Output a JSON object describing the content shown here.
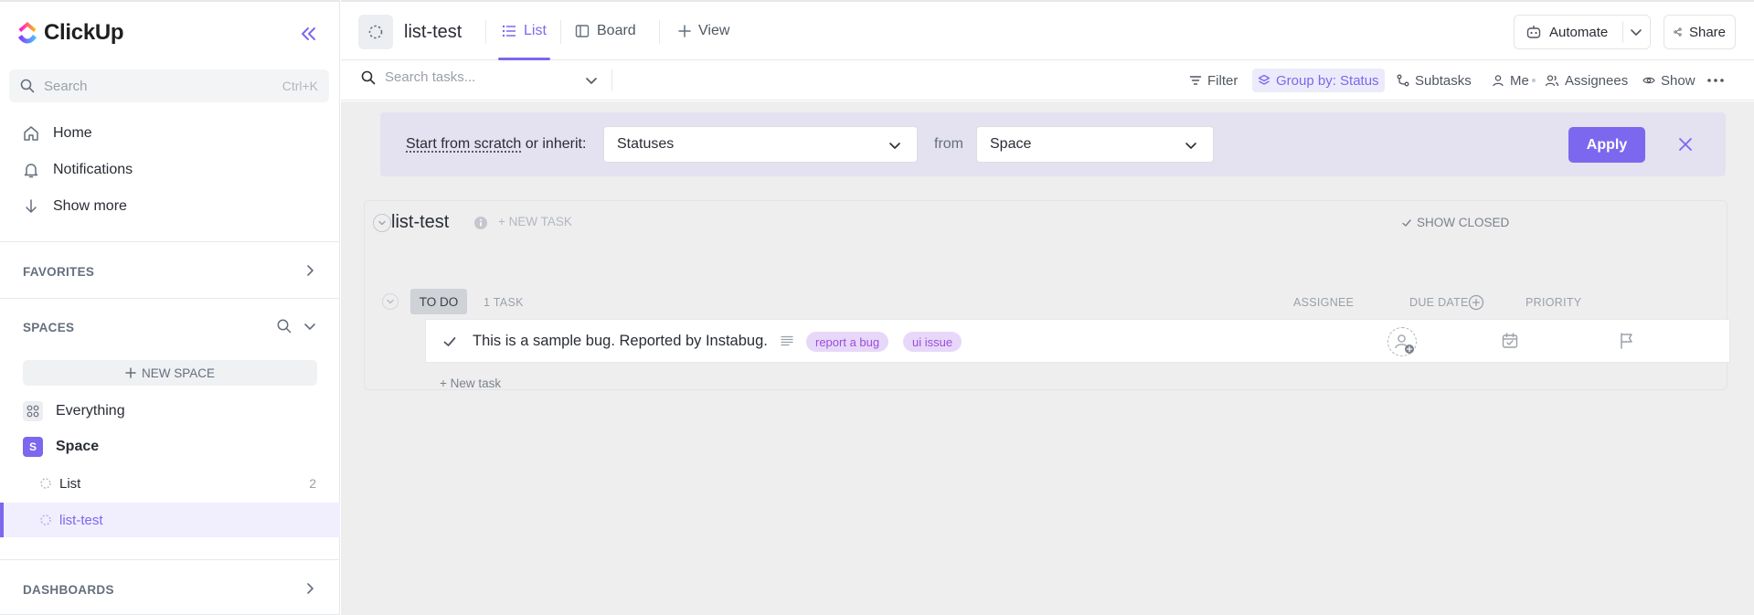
{
  "sidebar": {
    "brand": "ClickUp",
    "search": {
      "placeholder": "Search",
      "shortcut": "Ctrl+K"
    },
    "nav": [
      {
        "label": "Home",
        "icon": "home-icon"
      },
      {
        "label": "Notifications",
        "icon": "bell-icon"
      },
      {
        "label": "Show more",
        "icon": "arrow-down-icon"
      }
    ],
    "favorites_label": "FAVORITES",
    "spaces_label": "SPACES",
    "new_space_label": "NEW SPACE",
    "everything_label": "Everything",
    "space": {
      "initial": "S",
      "name": "Space"
    },
    "lists": [
      {
        "name": "List",
        "count": "2"
      },
      {
        "name": "list-test",
        "count": ""
      }
    ],
    "dashboards_label": "DASHBOARDS"
  },
  "header": {
    "list_title": "list-test",
    "tabs": [
      {
        "label": "List",
        "icon": "list-icon",
        "active": true
      },
      {
        "label": "Board",
        "icon": "board-icon",
        "active": false
      }
    ],
    "add_view_label": "View",
    "automate_label": "Automate",
    "share_label": "Share"
  },
  "toolbar": {
    "search_placeholder": "Search tasks...",
    "filter_label": "Filter",
    "group_by_label": "Group by: Status",
    "subtasks_label": "Subtasks",
    "me_label": "Me",
    "assignees_label": "Assignees",
    "show_label": "Show"
  },
  "banner": {
    "lead_link": "Start from scratch",
    "lead_rest": " or inherit:",
    "statuses_value": "Statuses",
    "from_label": "from",
    "source_value": "Space",
    "apply_label": "Apply"
  },
  "list_panel": {
    "title": "list-test",
    "new_task_label": "+ NEW TASK",
    "show_closed_label": "SHOW CLOSED",
    "group": {
      "status": "TO DO",
      "task_count": "1 TASK",
      "columns": [
        "ASSIGNEE",
        "DUE DATE",
        "PRIORITY"
      ]
    },
    "tasks": [
      {
        "name": "This is a sample bug. Reported by Instabug.",
        "tags": [
          "report a bug",
          "ui issue"
        ]
      }
    ],
    "new_task_link": "+ New task"
  },
  "colors": {
    "accent": "#7b68ee",
    "banner_bg": "#e4e1f0",
    "tag_bg": "#e7d8fa",
    "tag_text": "#9b4ed8"
  }
}
